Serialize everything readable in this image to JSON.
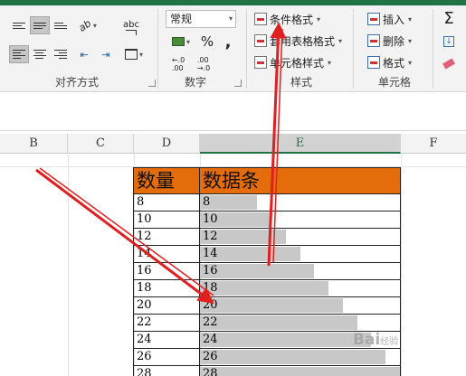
{
  "ribbon": {
    "alignment": {
      "label": "对齐方式",
      "orientation_glyph": "ab",
      "wrap_glyph": "abc"
    },
    "number": {
      "label": "数字",
      "format_value": "常规",
      "percent": "%",
      "comma": ",",
      "inc_decimal": "←.0\n.00",
      "dec_decimal": ".00\n→.0"
    },
    "styles": {
      "label": "样式",
      "label_visible": "样式",
      "conditional_format": "条件格式",
      "format_as_table": "套用表格格式",
      "cell_styles": "单元格样式"
    },
    "cells": {
      "label": "单元格",
      "insert": "插入",
      "delete": "删除",
      "format": "格式"
    },
    "editing": {
      "sum_glyph": "Σ"
    }
  },
  "columns": [
    {
      "name": "B"
    },
    {
      "name": "C"
    },
    {
      "name": "D"
    },
    {
      "name": "E",
      "active": true
    },
    {
      "name": "F"
    }
  ],
  "table": {
    "headers": [
      "数量",
      "数据条"
    ],
    "rows": [
      {
        "qty": "8",
        "bar": "8",
        "fill": 0.286
      },
      {
        "qty": "10",
        "bar": "10",
        "fill": 0.357
      },
      {
        "qty": "12",
        "bar": "12",
        "fill": 0.429
      },
      {
        "qty": "14",
        "bar": "14",
        "fill": 0.5
      },
      {
        "qty": "16",
        "bar": "16",
        "fill": 0.571
      },
      {
        "qty": "18",
        "bar": "18",
        "fill": 0.643
      },
      {
        "qty": "20",
        "bar": "20",
        "fill": 0.714
      },
      {
        "qty": "22",
        "bar": "22",
        "fill": 0.786
      },
      {
        "qty": "24",
        "bar": "24",
        "fill": 0.857
      },
      {
        "qty": "26",
        "bar": "26",
        "fill": 0.929
      },
      {
        "qty": "28",
        "bar": "28",
        "fill": 1.0
      }
    ]
  },
  "colors": {
    "header_fill": "#e46c0a",
    "databar": "#c8c8c8",
    "arrow": "#e02020",
    "excel_green": "#217346"
  },
  "watermark": {
    "text": "Bai",
    "suffix": "经验"
  }
}
